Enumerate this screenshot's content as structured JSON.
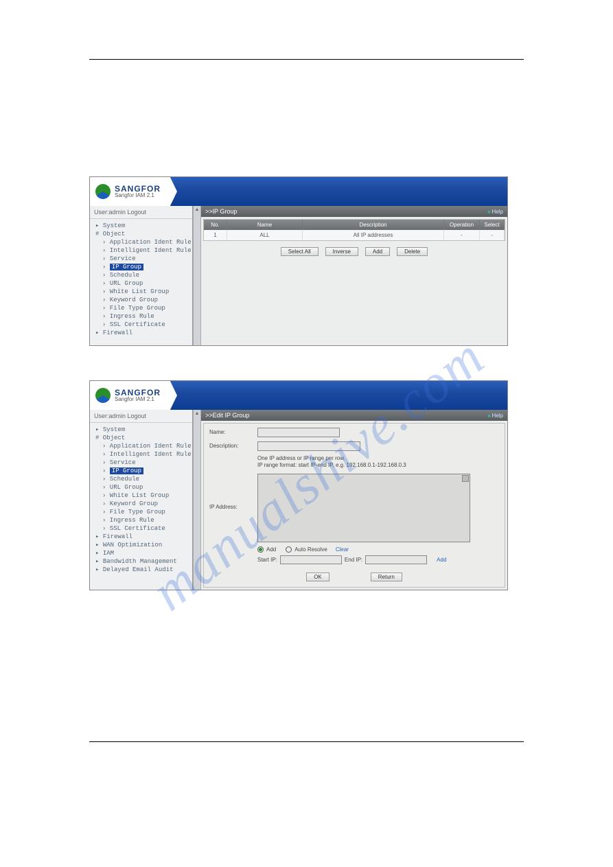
{
  "brand": {
    "name": "SANGFOR",
    "sub": "Sangfor IAM 2.1"
  },
  "screen1": {
    "user": "User:admin Logout",
    "tree": [
      {
        "lvl": 1,
        "label": "▸ System",
        "sel": false
      },
      {
        "lvl": 1,
        "label": "# Object",
        "sel": false
      },
      {
        "lvl": 2,
        "label": "› Application Ident Rule",
        "sel": false
      },
      {
        "lvl": 2,
        "label": "› Intelligent Ident Rule",
        "sel": false
      },
      {
        "lvl": 2,
        "label": "› Service",
        "sel": false
      },
      {
        "lvl": 2,
        "label": "› IP Group",
        "sel": true
      },
      {
        "lvl": 2,
        "label": "› Schedule",
        "sel": false
      },
      {
        "lvl": 2,
        "label": "› URL Group",
        "sel": false
      },
      {
        "lvl": 2,
        "label": "› White List Group",
        "sel": false
      },
      {
        "lvl": 2,
        "label": "› Keyword Group",
        "sel": false
      },
      {
        "lvl": 2,
        "label": "› File Type Group",
        "sel": false
      },
      {
        "lvl": 2,
        "label": "› Ingress Rule",
        "sel": false
      },
      {
        "lvl": 2,
        "label": "› SSL Certificate",
        "sel": false
      },
      {
        "lvl": 1,
        "label": "▸ Firewall",
        "sel": false
      }
    ],
    "title": ">>IP Group",
    "help": "Help",
    "cols": {
      "no": "No.",
      "name": "Name",
      "desc": "Description",
      "op": "Operation",
      "sel": "Select"
    },
    "rows": [
      {
        "no": "1",
        "name": "ALL",
        "desc": "All IP addresses",
        "op": "-",
        "sel": "-"
      }
    ],
    "buttons": {
      "selectAll": "Select All",
      "inverse": "Inverse",
      "add": "Add",
      "delete": "Delete"
    }
  },
  "screen2": {
    "user": "User:admin Logout",
    "tree": [
      {
        "lvl": 1,
        "label": "▸ System",
        "sel": false
      },
      {
        "lvl": 1,
        "label": "# Object",
        "sel": false
      },
      {
        "lvl": 2,
        "label": "› Application Ident Rule",
        "sel": false
      },
      {
        "lvl": 2,
        "label": "› Intelligent Ident Rule",
        "sel": false
      },
      {
        "lvl": 2,
        "label": "› Service",
        "sel": false
      },
      {
        "lvl": 2,
        "label": "› IP Group",
        "sel": true
      },
      {
        "lvl": 2,
        "label": "› Schedule",
        "sel": false
      },
      {
        "lvl": 2,
        "label": "› URL Group",
        "sel": false
      },
      {
        "lvl": 2,
        "label": "› White List Group",
        "sel": false
      },
      {
        "lvl": 2,
        "label": "› Keyword Group",
        "sel": false
      },
      {
        "lvl": 2,
        "label": "› File Type Group",
        "sel": false
      },
      {
        "lvl": 2,
        "label": "› Ingress Rule",
        "sel": false
      },
      {
        "lvl": 2,
        "label": "› SSL Certificate",
        "sel": false
      },
      {
        "lvl": 1,
        "label": "▸ Firewall",
        "sel": false
      },
      {
        "lvl": 1,
        "label": "▸ WAN Optimization",
        "sel": false
      },
      {
        "lvl": 1,
        "label": "▸ IAM",
        "sel": false
      },
      {
        "lvl": 1,
        "label": "▸ Bandwidth Management",
        "sel": false
      },
      {
        "lvl": 1,
        "label": "▸ Delayed Email Audit",
        "sel": false
      }
    ],
    "title": ">>Edit IP Group",
    "help": "Help",
    "form": {
      "nameLabel": "Name:",
      "descLabel": "Description:",
      "hint1": "One IP address or IP range per row.",
      "hint2": "IP range format: start IP-end IP, e.g. 192.168.0.1-192.168.0.3",
      "ipLabel": "IP Address:",
      "radioAdd": "Add",
      "radioAuto": "Auto Resolve",
      "clear": "Clear",
      "startIp": "Start IP:",
      "endIp": "End IP:",
      "addLink": "Add",
      "ok": "OK",
      "return": "Return"
    }
  },
  "watermark": "manualshive.com"
}
